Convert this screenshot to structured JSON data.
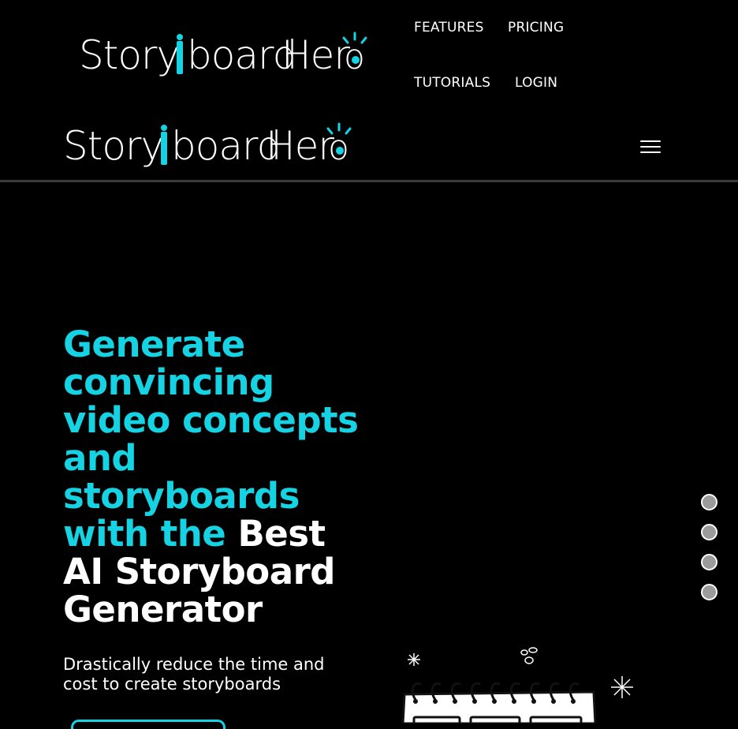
{
  "brand": {
    "name_parts": [
      "Story",
      "board",
      "Her",
      "o"
    ],
    "accent_color": "#16d3e4",
    "text_color": "#ffffff",
    "background_color": "#000000"
  },
  "nav": {
    "items": [
      {
        "label": "FEATURES"
      },
      {
        "label": "PRICING"
      },
      {
        "label": "TUTORIALS"
      },
      {
        "label": "LOGIN"
      }
    ]
  },
  "sticky_header": {
    "menu_icon": "hamburger-menu-icon"
  },
  "hero": {
    "title_accent": "Generate convincing video concepts and storyboards with the ",
    "title_plain": "Best AI Storyboard Generator",
    "subtitle": "Drastically reduce the time and cost to create storyboards"
  },
  "section_dots": {
    "count": 4,
    "icon": "section-dot-icon"
  },
  "illustration": {
    "icon": "storyboard-notepad-illustration"
  }
}
